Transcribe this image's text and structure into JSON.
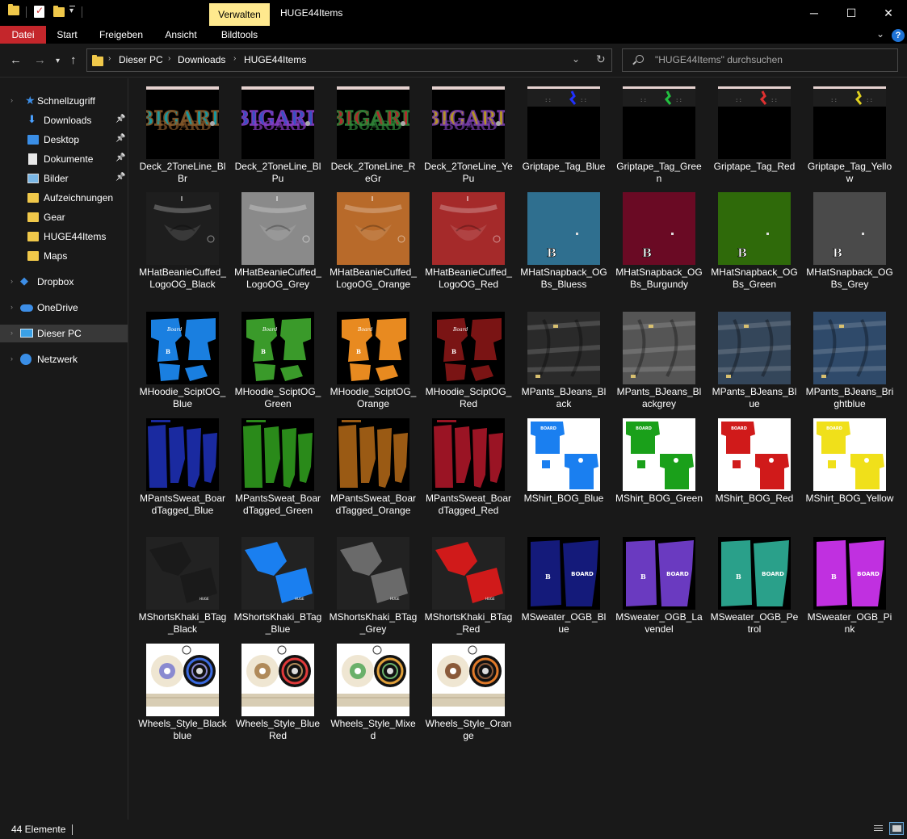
{
  "window": {
    "title": "HUGE44Items",
    "context_tab": "Verwalten",
    "controls": {
      "minimize": "─",
      "maximize": "☐",
      "close": "✕"
    }
  },
  "ribbon": {
    "tabs": [
      "Datei",
      "Start",
      "Freigeben",
      "Ansicht",
      "Bildtools"
    ],
    "help": "?"
  },
  "addressbar": {
    "breadcrumbs": [
      "Dieser PC",
      "Downloads",
      "HUGE44Items"
    ],
    "search_placeholder": "\"HUGE44Items\" durchsuchen"
  },
  "sidebar": {
    "items": [
      {
        "label": "Schnellzugriff",
        "icon": "star-icon",
        "pinned": false
      },
      {
        "label": "Downloads",
        "icon": "download-icon",
        "pinned": true
      },
      {
        "label": "Desktop",
        "icon": "desktop-icon",
        "pinned": true
      },
      {
        "label": "Dokumente",
        "icon": "document-icon",
        "pinned": true
      },
      {
        "label": "Bilder",
        "icon": "pictures-icon",
        "pinned": true
      },
      {
        "label": "Aufzeichnungen",
        "icon": "folder-icon",
        "pinned": false
      },
      {
        "label": "Gear",
        "icon": "folder-icon",
        "pinned": false
      },
      {
        "label": "HUGE44Items",
        "icon": "folder-icon",
        "pinned": false
      },
      {
        "label": "Maps",
        "icon": "folder-icon",
        "pinned": false
      },
      {
        "label": "Dropbox",
        "icon": "dropbox-icon",
        "pinned": false
      },
      {
        "label": "OneDrive",
        "icon": "cloud-icon",
        "pinned": false
      },
      {
        "label": "Dieser PC",
        "icon": "computer-icon",
        "pinned": false,
        "active": true
      },
      {
        "label": "Netzwerk",
        "icon": "network-icon",
        "pinned": false
      }
    ]
  },
  "files": [
    {
      "name": "Deck_2ToneLine_BlBr",
      "kind": "deck",
      "colors": [
        "#1aa7b0",
        "#8a5a2a"
      ]
    },
    {
      "name": "Deck_2ToneLine_BlPu",
      "kind": "deck",
      "colors": [
        "#3b5bd6",
        "#8b3fc9"
      ]
    },
    {
      "name": "Deck_2ToneLine_ReGr",
      "kind": "deck",
      "colors": [
        "#c03030",
        "#2f8a3a"
      ]
    },
    {
      "name": "Deck_2ToneLine_YePu",
      "kind": "deck",
      "colors": [
        "#c7a52a",
        "#7a3fb0"
      ]
    },
    {
      "name": "Griptape_Tag_Blue",
      "kind": "grip",
      "colors": [
        "#2030ff"
      ]
    },
    {
      "name": "Griptape_Tag_Green",
      "kind": "grip",
      "colors": [
        "#22c040"
      ]
    },
    {
      "name": "Griptape_Tag_Red",
      "kind": "grip",
      "colors": [
        "#e03030"
      ]
    },
    {
      "name": "Griptape_Tag_Yellow",
      "kind": "grip",
      "colors": [
        "#e0d020"
      ]
    },
    {
      "name": "MHatBeanieCuffed_LogoOG_Black",
      "kind": "beanie",
      "colors": [
        "#1e1e1e"
      ]
    },
    {
      "name": "MHatBeanieCuffed_LogoOG_Grey",
      "kind": "beanie",
      "colors": [
        "#8a8a8a"
      ]
    },
    {
      "name": "MHatBeanieCuffed_LogoOG_Orange",
      "kind": "beanie",
      "colors": [
        "#b86a2a"
      ]
    },
    {
      "name": "MHatBeanieCuffed_LogoOG_Red",
      "kind": "beanie",
      "colors": [
        "#a52a2a"
      ]
    },
    {
      "name": "MHatSnapback_OGBs_Bluess",
      "kind": "snap",
      "colors": [
        "#2f6f8f"
      ]
    },
    {
      "name": "MHatSnapback_OGBs_Burgundy",
      "kind": "snap",
      "colors": [
        "#6a0a24"
      ]
    },
    {
      "name": "MHatSnapback_OGBs_Green",
      "kind": "snap",
      "colors": [
        "#2f6a0a"
      ]
    },
    {
      "name": "MHatSnapback_OGBs_Grey",
      "kind": "snap",
      "colors": [
        "#4a4a4a"
      ]
    },
    {
      "name": "MHoodie_SciptOG_Blue",
      "kind": "hoodie",
      "colors": [
        "#1a7fe0"
      ]
    },
    {
      "name": "MHoodie_SciptOG_Green",
      "kind": "hoodie",
      "colors": [
        "#3a9a2a"
      ]
    },
    {
      "name": "MHoodie_SciptOG_Orange",
      "kind": "hoodie",
      "colors": [
        "#e88a20"
      ]
    },
    {
      "name": "MHoodie_SciptOG_Red",
      "kind": "hoodie",
      "colors": [
        "#7a1414"
      ]
    },
    {
      "name": "MPants_BJeans_Black",
      "kind": "jeans",
      "colors": [
        "#2a2a2a"
      ]
    },
    {
      "name": "MPants_BJeans_Blackgrey",
      "kind": "jeans",
      "colors": [
        "#555555"
      ]
    },
    {
      "name": "MPants_BJeans_Blue",
      "kind": "jeans",
      "colors": [
        "#34465a"
      ]
    },
    {
      "name": "MPants_BJeans_Brightblue",
      "kind": "jeans",
      "colors": [
        "#2f4a6a"
      ]
    },
    {
      "name": "MPantsSweat_BoardTagged_Blue",
      "kind": "sweat",
      "colors": [
        "#1a2aa0"
      ]
    },
    {
      "name": "MPantsSweat_BoardTagged_Green",
      "kind": "sweat",
      "colors": [
        "#2a8a1a"
      ]
    },
    {
      "name": "MPantsSweat_BoardTagged_Orange",
      "kind": "sweat",
      "colors": [
        "#9a5a14"
      ]
    },
    {
      "name": "MPantsSweat_BoardTagged_Red",
      "kind": "sweat",
      "colors": [
        "#9a1424"
      ]
    },
    {
      "name": "MShirt_BOG_Blue",
      "kind": "shirt",
      "colors": [
        "#1a7ff0"
      ]
    },
    {
      "name": "MShirt_BOG_Green",
      "kind": "shirt",
      "colors": [
        "#1aa01a"
      ]
    },
    {
      "name": "MShirt_BOG_Red",
      "kind": "shirt",
      "colors": [
        "#d01a1a"
      ]
    },
    {
      "name": "MShirt_BOG_Yellow",
      "kind": "shirt",
      "colors": [
        "#f0e01a"
      ]
    },
    {
      "name": "MShortsKhaki_BTag_Black",
      "kind": "shorts",
      "colors": [
        "#1a1a1a"
      ]
    },
    {
      "name": "MShortsKhaki_BTag_Blue",
      "kind": "shorts",
      "colors": [
        "#1a7ff0"
      ]
    },
    {
      "name": "MShortsKhaki_BTag_Grey",
      "kind": "shorts",
      "colors": [
        "#6a6a6a"
      ]
    },
    {
      "name": "MShortsKhaki_BTag_Red",
      "kind": "shorts",
      "colors": [
        "#d01a1a"
      ]
    },
    {
      "name": "MSweater_OGB_Blue",
      "kind": "sweater",
      "colors": [
        "#141a7a"
      ]
    },
    {
      "name": "MSweater_OGB_Lavendel",
      "kind": "sweater",
      "colors": [
        "#6a3ac0"
      ]
    },
    {
      "name": "MSweater_OGB_Petrol",
      "kind": "sweater",
      "colors": [
        "#2aa08a"
      ]
    },
    {
      "name": "MSweater_OGB_Pink",
      "kind": "sweater",
      "colors": [
        "#c030e0"
      ]
    },
    {
      "name": "Wheels_Style_Blackblue",
      "kind": "wheels",
      "colors": [
        "#8a8ad0",
        "#3a6ae0"
      ]
    },
    {
      "name": "Wheels_Style_BlueRed",
      "kind": "wheels",
      "colors": [
        "#b08a5a",
        "#e03a3a"
      ]
    },
    {
      "name": "Wheels_Style_Mixed",
      "kind": "wheels",
      "colors": [
        "#6ab06a",
        "#e0a03a"
      ]
    },
    {
      "name": "Wheels_Style_Orange",
      "kind": "wheels",
      "colors": [
        "#8a5a3a",
        "#e07a2a"
      ]
    }
  ],
  "status": {
    "count_text": "44 Elemente"
  }
}
